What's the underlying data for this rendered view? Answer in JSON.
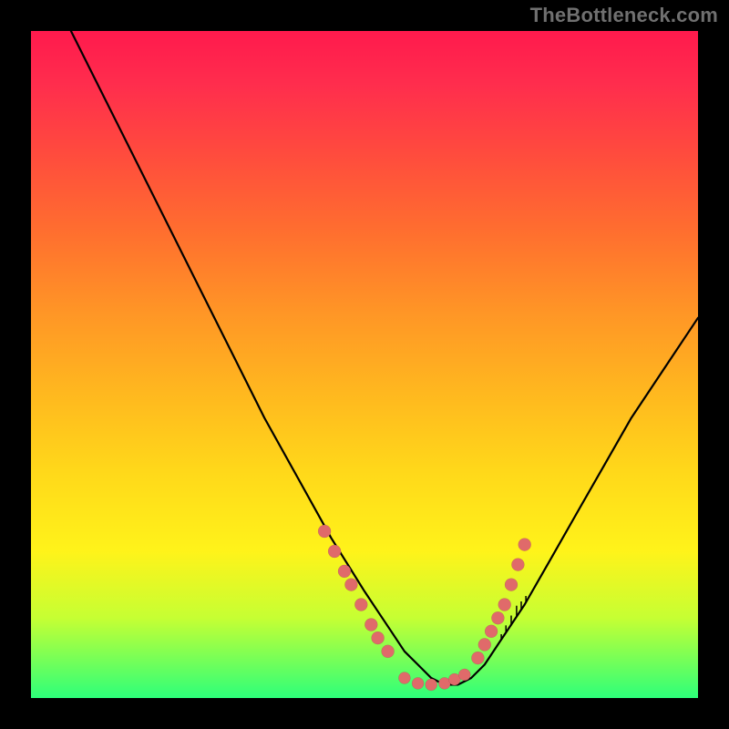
{
  "watermark": "TheBottleneck.com",
  "chart_data": {
    "type": "line",
    "title": "",
    "xlabel": "",
    "ylabel": "",
    "xlim": [
      0,
      100
    ],
    "ylim": [
      0,
      100
    ],
    "legend": null,
    "grid": false,
    "series": [
      {
        "name": "bottleneck-curve",
        "x": [
          6,
          10,
          15,
          20,
          25,
          30,
          35,
          40,
          45,
          50,
          52,
          54,
          56,
          58,
          60,
          62,
          64,
          66,
          68,
          70,
          74,
          78,
          82,
          86,
          90,
          94,
          98,
          100
        ],
        "y": [
          100,
          92,
          82,
          72,
          62,
          52,
          42,
          33,
          24,
          16,
          13,
          10,
          7,
          5,
          3,
          2,
          2,
          3,
          5,
          8,
          14,
          21,
          28,
          35,
          42,
          48,
          54,
          57
        ]
      }
    ],
    "markers_left": {
      "name": "left-cluster",
      "x": [
        44,
        45.5,
        47,
        48,
        49.5,
        51,
        52,
        53.5
      ],
      "y": [
        25,
        22,
        19,
        17,
        14,
        11,
        9,
        7
      ]
    },
    "markers_bottom": {
      "name": "bottom-cluster",
      "x": [
        56,
        58,
        60,
        62,
        63.5,
        65
      ],
      "y": [
        3,
        2.2,
        2,
        2.2,
        2.8,
        3.5
      ]
    },
    "markers_right": {
      "name": "right-cluster",
      "x": [
        67,
        68,
        69,
        70,
        71,
        72,
        73,
        74
      ],
      "y": [
        6,
        8,
        10,
        12,
        14,
        17,
        20,
        23
      ]
    },
    "right_ticks": {
      "name": "right-axis-ticks",
      "x": [
        70.5,
        71.2,
        72,
        72.8,
        73.5,
        74.2
      ],
      "len": [
        6,
        8,
        10,
        12,
        9,
        7
      ]
    }
  }
}
